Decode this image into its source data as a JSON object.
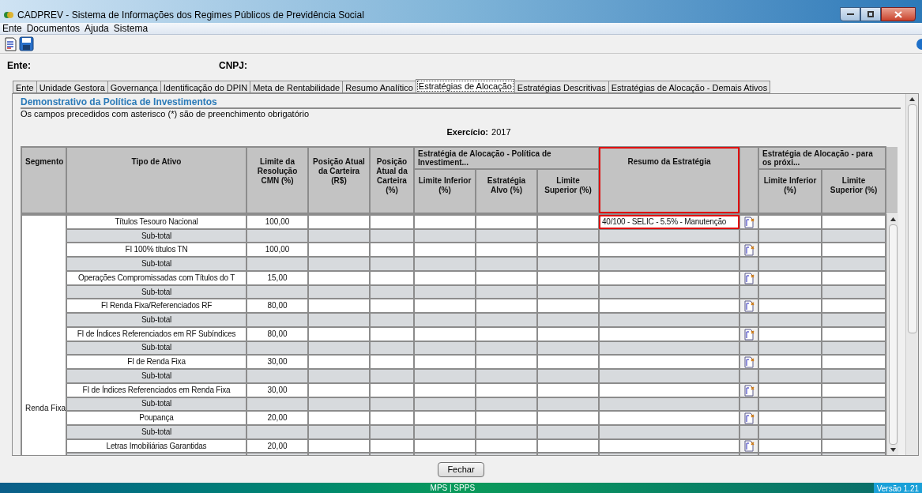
{
  "window": {
    "title": "CADPREV - Sistema de Informações dos Regimes Públicos de Previdência Social"
  },
  "menu": [
    "Ente",
    "Documentos",
    "Ajuda",
    "Sistema"
  ],
  "header_fields": [
    {
      "label": "Ente:"
    },
    {
      "label": "CNPJ:"
    }
  ],
  "tabs": [
    {
      "label": "Ente",
      "selected": false
    },
    {
      "label": "Unidade Gestora",
      "selected": false
    },
    {
      "label": "Governança",
      "selected": false
    },
    {
      "label": "Identificação do DPIN",
      "selected": false
    },
    {
      "label": "Meta de Rentabilidade",
      "selected": false
    },
    {
      "label": "Resumo Analítico",
      "selected": false
    },
    {
      "label": "Estratégias de Alocação",
      "selected": true
    },
    {
      "label": "Estratégias Descritivas",
      "selected": false
    },
    {
      "label": "Estratégias de Alocação - Demais Ativos",
      "selected": false
    }
  ],
  "panel": {
    "title": "Demonstrativo da Política de Investimentos",
    "note": "Os campos precedidos com asterisco (*) são de preenchimento obrigatório",
    "exercise_label": "Exercício:",
    "exercise_value": "2017"
  },
  "table": {
    "header": [
      {
        "kind": "single",
        "label": "Segmento"
      },
      {
        "kind": "single",
        "label": "Tipo de Ativo"
      },
      {
        "kind": "single",
        "label": "Limite da Resolução CMN (%)"
      },
      {
        "kind": "single",
        "label": "Posição Atual da Carteira (R$)"
      },
      {
        "kind": "single",
        "label": "Posição Atual da Carteira (%)"
      },
      {
        "kind": "group",
        "label": "Estratégia de Alocação - Política de Investiment...",
        "columns": [
          "Limite Inferior (%)",
          "Estratégia Alvo (%)",
          "Limite Superior (%)"
        ]
      },
      {
        "kind": "single",
        "label": "Resumo da Estratégia",
        "highlighted": true
      },
      {
        "kind": "action"
      },
      {
        "kind": "group",
        "label": "Estratégia de Alocação - para os próxi...",
        "columns": [
          "Limite Inferior (%)",
          "Limite Superior (%)"
        ]
      }
    ],
    "segment": "Renda Fixa",
    "rows": [
      {
        "kind": "asset",
        "name": "Títulos Tesouro Nacional",
        "limit": "100,00",
        "summary": "40/100 - SELIC - 5.5% - Manutenção"
      },
      {
        "kind": "subtotal",
        "name": "Sub-total"
      },
      {
        "kind": "asset",
        "name": "FI 100% títulos TN",
        "limit": "100,00"
      },
      {
        "kind": "subtotal",
        "name": "Sub-total"
      },
      {
        "kind": "asset",
        "name": "Operações Compromissadas com Títulos do T",
        "limit": "15,00"
      },
      {
        "kind": "subtotal",
        "name": "Sub-total"
      },
      {
        "kind": "asset",
        "name": "FI Renda Fixa/Referenciados RF",
        "limit": "80,00"
      },
      {
        "kind": "subtotal",
        "name": "Sub-total"
      },
      {
        "kind": "asset",
        "name": "FI de Índices Referenciados em RF Subíndices",
        "limit": "80,00"
      },
      {
        "kind": "subtotal",
        "name": "Sub-total"
      },
      {
        "kind": "asset",
        "name": "FI de Renda Fixa",
        "limit": "30,00"
      },
      {
        "kind": "subtotal",
        "name": "Sub-total"
      },
      {
        "kind": "asset",
        "name": "FI de Índices Referenciados em Renda Fixa",
        "limit": "30,00"
      },
      {
        "kind": "subtotal",
        "name": "Sub-total"
      },
      {
        "kind": "asset",
        "name": "Poupança",
        "limit": "20,00"
      },
      {
        "kind": "subtotal",
        "name": "Sub-total"
      },
      {
        "kind": "asset",
        "name": "Letras Imobiliárias Garantidas",
        "limit": "20,00"
      }
    ]
  },
  "buttons": [
    "Fechar"
  ],
  "status_bar": {
    "center": "MPS | SPPS",
    "version": "Versão 1.21"
  }
}
